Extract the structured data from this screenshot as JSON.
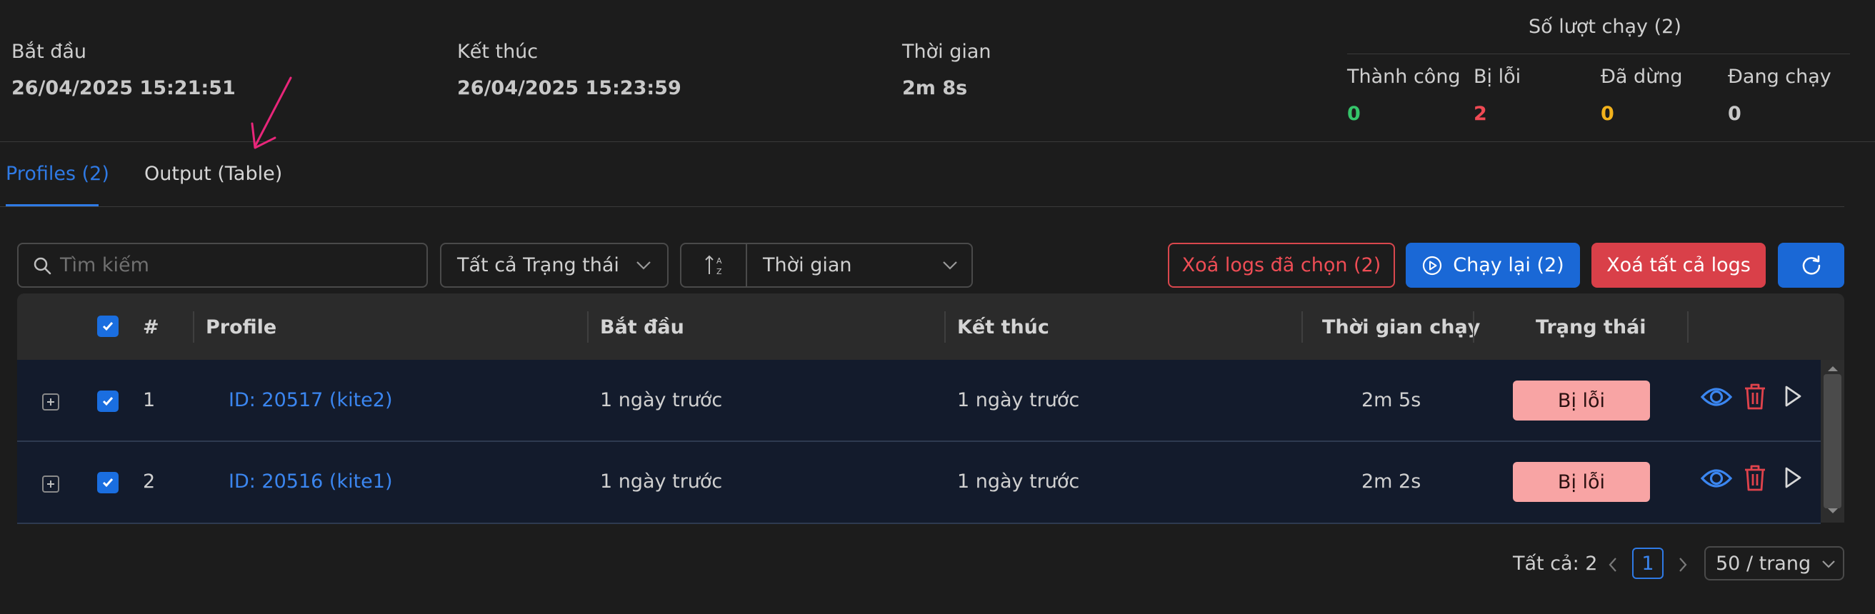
{
  "summary": {
    "start": {
      "label": "Bắt đầu",
      "value": "26/04/2025 15:21:51"
    },
    "end": {
      "label": "Kết thúc",
      "value": "26/04/2025 15:23:59"
    },
    "duration": {
      "label": "Thời gian",
      "value": "2m 8s"
    },
    "runs": {
      "title": "Số lượt chạy (2)",
      "success": {
        "label": "Thành công",
        "value": "0",
        "color": "#35c46a"
      },
      "error": {
        "label": "Bị lỗi",
        "value": "2",
        "color": "#f04a54"
      },
      "stopped": {
        "label": "Đã dừng",
        "value": "0",
        "color": "#f2b21c"
      },
      "running": {
        "label": "Đang chạy",
        "value": "0",
        "color": "#cfcfcf"
      }
    }
  },
  "tabs": [
    {
      "label": "Profiles (2)",
      "active": true
    },
    {
      "label": "Output (Table)",
      "active": false
    }
  ],
  "toolbar": {
    "search_placeholder": "Tìm kiếm",
    "status_filter": "Tất cả Trạng thái",
    "sort_icon": "sort-a-z-icon",
    "sort_field": "Thời gian",
    "delete_selected": "Xoá logs đã chọn (2)",
    "rerun": "Chạy lại (2)",
    "delete_all": "Xoá tất cả logs",
    "refresh_icon": "refresh-icon"
  },
  "table": {
    "headers": {
      "index": "#",
      "profile": "Profile",
      "start": "Bắt đầu",
      "end": "Kết thúc",
      "runtime": "Thời gian chạy",
      "status": "Trạng thái"
    },
    "rows": [
      {
        "index": "1",
        "profile": "ID: 20517 (kite2)",
        "start": "1 ngày trước",
        "end": "1 ngày trước",
        "runtime": "2m 5s",
        "status": "Bị lỗi"
      },
      {
        "index": "2",
        "profile": "ID: 20516 (kite1)",
        "start": "1 ngày trước",
        "end": "1 ngày trước",
        "runtime": "2m 2s",
        "status": "Bị lỗi"
      }
    ]
  },
  "pagination": {
    "total": "Tất cả: 2",
    "current_page": "1",
    "page_size": "50 / trang"
  },
  "colors": {
    "accent": "#1a68d6",
    "danger": "#d94049",
    "annotation_arrow": "#e8267a"
  }
}
